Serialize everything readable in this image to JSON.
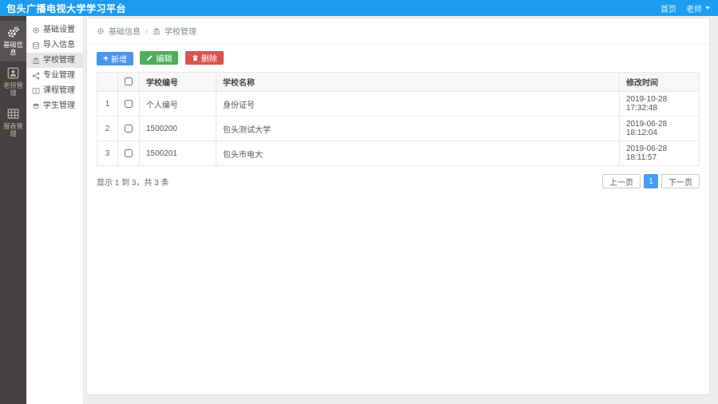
{
  "header": {
    "title": "包头广播电视大学学习平台",
    "nav_home": "首页",
    "user_name": "老师"
  },
  "rail": {
    "items": [
      {
        "label": "基础信息",
        "icon": "cogs-icon",
        "active": true
      },
      {
        "label": "老师管理",
        "icon": "id-badge-icon",
        "active": false
      },
      {
        "label": "报表管理",
        "icon": "report-icon",
        "active": false
      }
    ]
  },
  "submenu": {
    "items": [
      {
        "label": "基础设置",
        "icon": "gear-icon",
        "active": false
      },
      {
        "label": "导入信息",
        "icon": "database-icon",
        "active": false
      },
      {
        "label": "学校管理",
        "icon": "school-icon",
        "active": true
      },
      {
        "label": "专业管理",
        "icon": "share-icon",
        "active": false
      },
      {
        "label": "课程管理",
        "icon": "book-icon",
        "active": false
      },
      {
        "label": "学生管理",
        "icon": "graduation-cap-icon",
        "active": false
      }
    ]
  },
  "breadcrumb": {
    "parent": "基础信息",
    "separator": "›",
    "current": "学校管理"
  },
  "toolbar": {
    "add_label": "新增",
    "edit_label": "编辑",
    "delete_label": "删除"
  },
  "table": {
    "columns": {
      "code": "学校编号",
      "name": "学校名称",
      "time": "修改时间"
    },
    "rows": [
      {
        "index": "1",
        "code": "个人编号",
        "name": "身份证号",
        "time": "2019-10-28 17:32:48"
      },
      {
        "index": "2",
        "code": "1500200",
        "name": "包头测试大学",
        "time": "2019-06-28 18:12:04"
      },
      {
        "index": "3",
        "code": "1500201",
        "name": "包头市电大",
        "time": "2019-06-28 18:11:57"
      }
    ]
  },
  "footer": {
    "summary": "显示 1 到 3，共 3 条",
    "prev_label": "上一页",
    "page": "1",
    "next_label": "下一页"
  },
  "colors": {
    "header_blue": "#1d9df2",
    "button_blue": "#4795ee",
    "button_green": "#4fae5c",
    "button_red": "#d9534f",
    "page_active_blue": "#459df5",
    "rail_dark": "#454140"
  }
}
